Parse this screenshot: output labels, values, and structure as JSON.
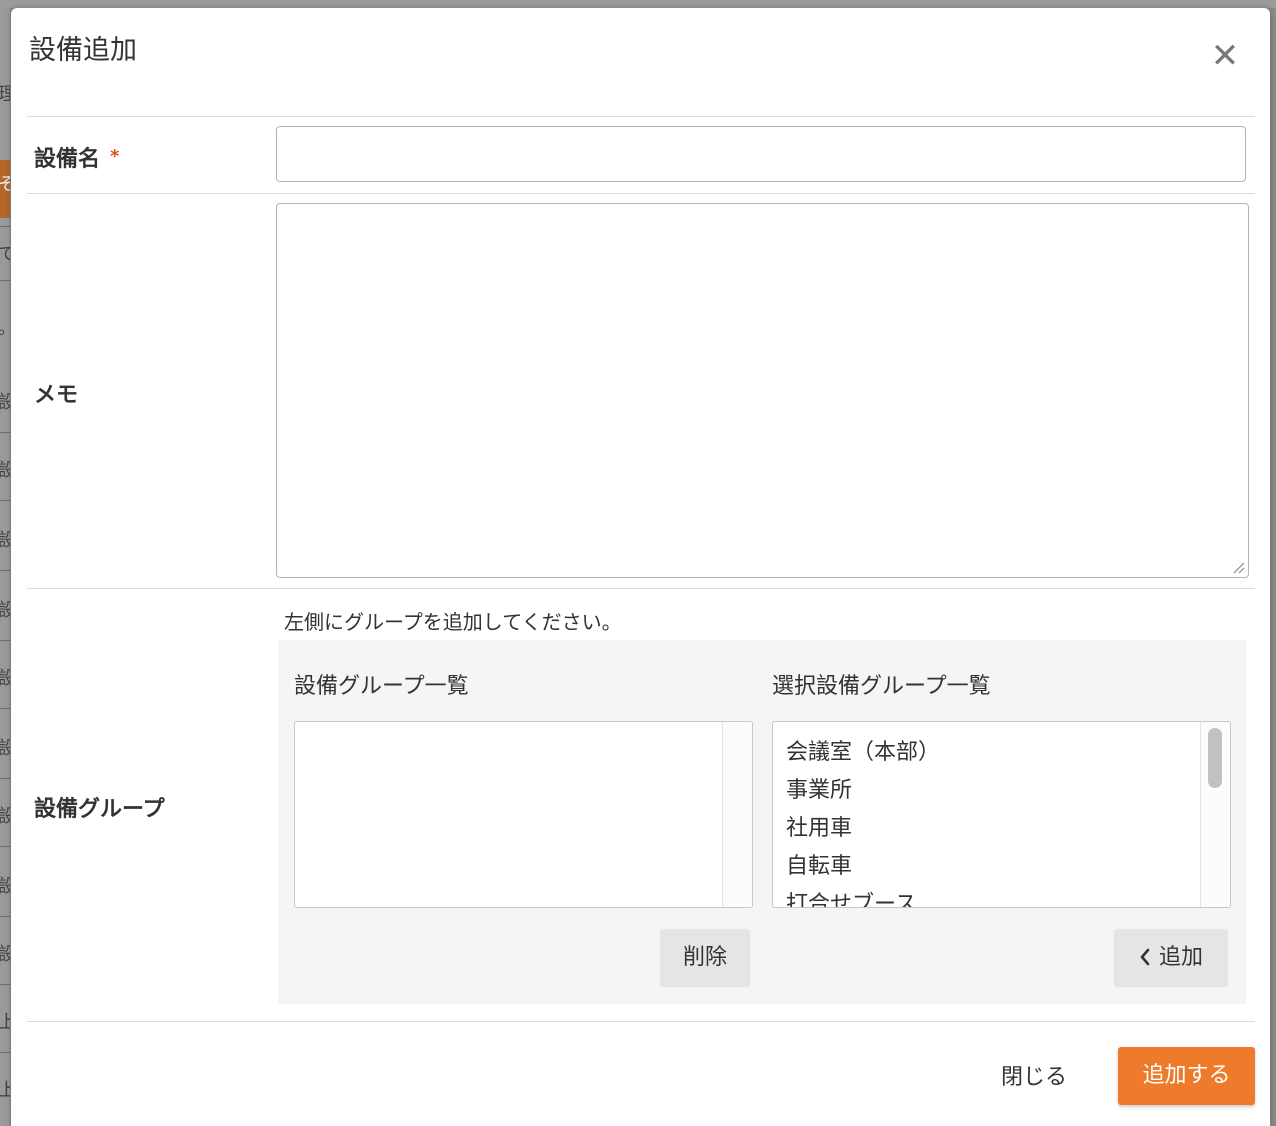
{
  "modal": {
    "title": "設備追加",
    "close_icon": "close-icon"
  },
  "form": {
    "name_label": "設備名",
    "required_mark": "*",
    "name_value": "",
    "memo_label": "メモ",
    "memo_value": "",
    "group_label": "設備グループ",
    "group_hint": "左側にグループを追加してください。"
  },
  "groups": {
    "available_title": "設備グループ一覧",
    "selected_title": "選択設備グループ一覧",
    "available_items": [],
    "selected_items": [
      "会議室（本部）",
      "事業所",
      "社用車",
      "自転車",
      "打合せブース"
    ],
    "remove_label": "削除",
    "add_label": "追加",
    "add_icon": "chevron-left-icon"
  },
  "footer": {
    "close_label": "閉じる",
    "submit_label": "追加する"
  },
  "colors": {
    "accent": "#ee7a2b",
    "required": "#e0501a",
    "panel_bg": "#f5f5f5"
  },
  "background": {
    "glyphs": [
      "理",
      "そ",
      "て",
      "。",
      "設",
      "設",
      "設",
      "設",
      "設",
      "設",
      "設",
      "設",
      "設",
      "上",
      "上"
    ]
  }
}
